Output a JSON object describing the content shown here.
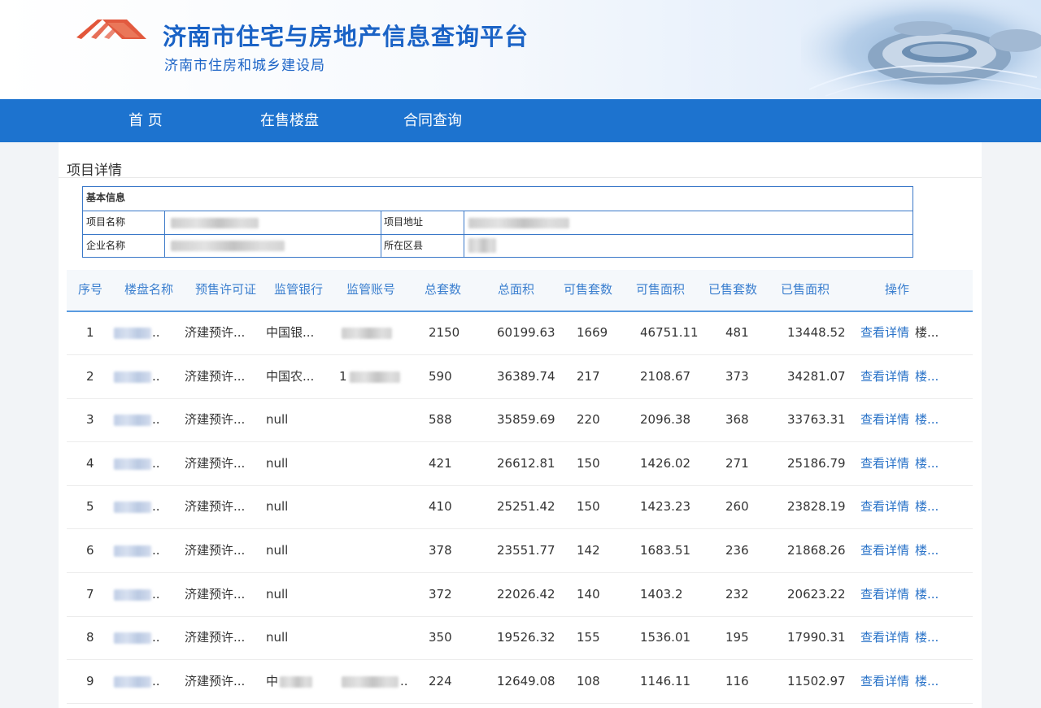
{
  "header": {
    "title": "济南市住宅与房地产信息查询平台",
    "subtitle": "济南市住房和城乡建设局"
  },
  "colors": {
    "brand_blue": "#1b63c6",
    "nav_blue": "#1d73cf",
    "link_blue": "#2a73c8",
    "logo_red": "#e2563a"
  },
  "nav": [
    {
      "label": "首  页"
    },
    {
      "label": "在售楼盘"
    },
    {
      "label": "合同查询"
    }
  ],
  "section_title": "项目详情",
  "basic_info": {
    "heading": "基本信息",
    "project_name_label": "项目名称",
    "project_address_label": "项目地址",
    "company_name_label": "企业名称",
    "district_label": "所在区县"
  },
  "table": {
    "columns": [
      "序号",
      "楼盘名称",
      "预售许可证",
      "监管银行",
      "监管账号",
      "总套数",
      "总面积",
      "可售套数",
      "可售面积",
      "已售套数",
      "已售面积",
      "操作"
    ],
    "action_label": "查看详情",
    "rows": [
      {
        "index": "1",
        "name": "..",
        "permit": "济建预许...",
        "bank": "中国银...",
        "account": "",
        "total_units": "2150",
        "total_area": "60199.63",
        "avail_units": "1669",
        "avail_area": "46751.11",
        "sold_units": "481",
        "sold_area": "13448.52",
        "extra": "楼..."
      },
      {
        "index": "2",
        "name": "..",
        "permit": "济建预许...",
        "bank": "中国农...",
        "account": "1",
        "total_units": "590",
        "total_area": "36389.74",
        "avail_units": "217",
        "avail_area": "2108.67",
        "sold_units": "373",
        "sold_area": "34281.07",
        "extra": "楼..."
      },
      {
        "index": "3",
        "name": "..",
        "permit": "济建预许...",
        "bank": "null",
        "account": "",
        "total_units": "588",
        "total_area": "35859.69",
        "avail_units": "220",
        "avail_area": "2096.38",
        "sold_units": "368",
        "sold_area": "33763.31",
        "extra": "楼..."
      },
      {
        "index": "4",
        "name": "..",
        "permit": "济建预许...",
        "bank": "null",
        "account": "",
        "total_units": "421",
        "total_area": "26612.81",
        "avail_units": "150",
        "avail_area": "1426.02",
        "sold_units": "271",
        "sold_area": "25186.79",
        "extra": "楼..."
      },
      {
        "index": "5",
        "name": "..",
        "permit": "济建预许...",
        "bank": "null",
        "account": "",
        "total_units": "410",
        "total_area": "25251.42",
        "avail_units": "150",
        "avail_area": "1423.23",
        "sold_units": "260",
        "sold_area": "23828.19",
        "extra": "楼..."
      },
      {
        "index": "6",
        "name": "..",
        "permit": "济建预许...",
        "bank": "null",
        "account": "",
        "total_units": "378",
        "total_area": "23551.77",
        "avail_units": "142",
        "avail_area": "1683.51",
        "sold_units": "236",
        "sold_area": "21868.26",
        "extra": "楼..."
      },
      {
        "index": "7",
        "name": "..",
        "permit": "济建预许...",
        "bank": "null",
        "account": "",
        "total_units": "372",
        "total_area": "22026.42",
        "avail_units": "140",
        "avail_area": "1403.2",
        "sold_units": "232",
        "sold_area": "20623.22",
        "extra": "楼..."
      },
      {
        "index": "8",
        "name": "..",
        "permit": "济建预许...",
        "bank": "null",
        "account": "",
        "total_units": "350",
        "total_area": "19526.32",
        "avail_units": "155",
        "avail_area": "1536.01",
        "sold_units": "195",
        "sold_area": "17990.31",
        "extra": "楼..."
      },
      {
        "index": "9",
        "name": "..",
        "permit": "济建预许...",
        "bank": "中",
        "account": "..",
        "total_units": "224",
        "total_area": "12649.08",
        "avail_units": "108",
        "avail_area": "1146.11",
        "sold_units": "116",
        "sold_area": "11502.97",
        "extra": "楼..."
      }
    ]
  }
}
